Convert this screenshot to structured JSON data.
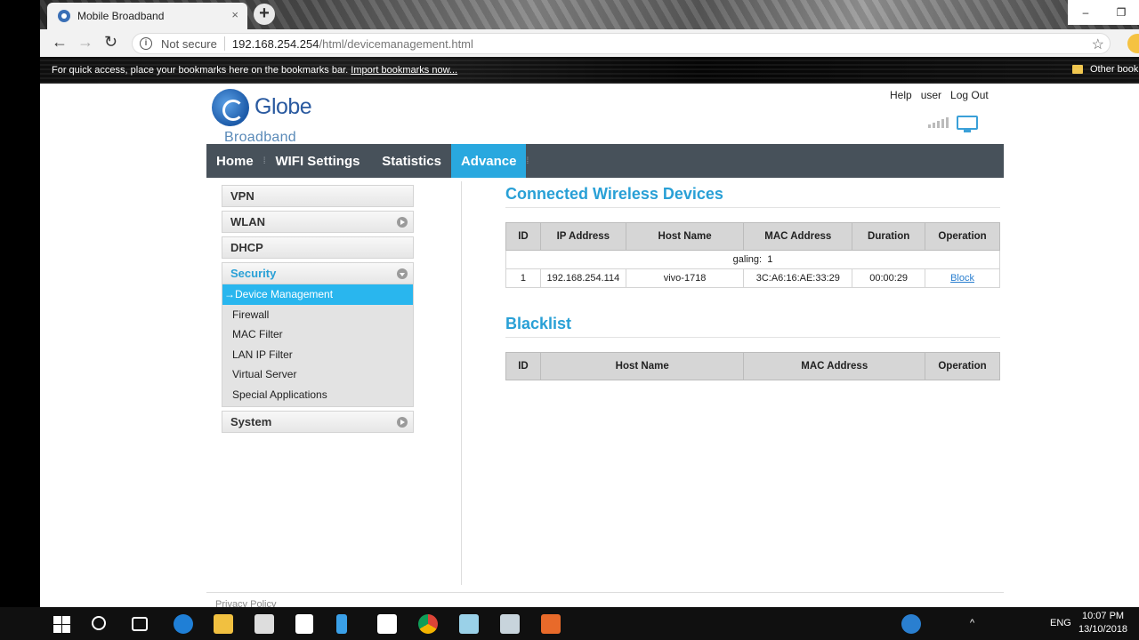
{
  "browser": {
    "tab_title": "Mobile Broadband",
    "tab_close": "×",
    "new_tab": "+",
    "window_min": "–",
    "window_restore": "❐",
    "security_label": "Not secure",
    "url_host": "192.168.254.254",
    "url_path": "/html/devicemanagement.html",
    "bookmarks_hint": "For quick access, place your bookmarks here on the bookmarks bar.",
    "bookmarks_import": "Import bookmarks now...",
    "other_bookmarks": "Other book"
  },
  "header": {
    "brand": "Globe",
    "sub_brand": "Broadband",
    "links": [
      "Help",
      "user",
      "Log Out"
    ]
  },
  "nav": {
    "items": [
      {
        "label": "Home",
        "active": false
      },
      {
        "label": "WIFI Settings",
        "active": false
      },
      {
        "label": "Statistics",
        "active": false
      },
      {
        "label": "Advance",
        "active": true
      }
    ]
  },
  "sidebar": {
    "vpn": "VPN",
    "wlan": "WLAN",
    "dhcp": "DHCP",
    "security": "Security",
    "security_items": [
      "→Device Management",
      "Firewall",
      "MAC Filter",
      "LAN IP Filter",
      "Virtual Server",
      "Special Applications"
    ],
    "system": "System"
  },
  "connected": {
    "title": "Connected Wireless Devices",
    "columns": [
      "ID",
      "IP Address",
      "Host Name",
      "MAC Address",
      "Duration",
      "Operation"
    ],
    "summary": "galing:  1",
    "rows": [
      {
        "id": "1",
        "ip": "192.168.254.114",
        "host": "vivo-1718",
        "mac": "3C:A6:16:AE:33:29",
        "duration": "00:00:29",
        "operation": "Block"
      }
    ]
  },
  "blacklist": {
    "title": "Blacklist",
    "columns": [
      "ID",
      "Host Name",
      "MAC Address",
      "Operation"
    ]
  },
  "footer": {
    "privacy": "Privacy Policy"
  },
  "taskbar": {
    "lang": "ENG",
    "time": "10:07 PM",
    "date": "13/10/2018"
  },
  "colors": {
    "accent": "#29a8df",
    "nav_bg": "#47515a"
  }
}
